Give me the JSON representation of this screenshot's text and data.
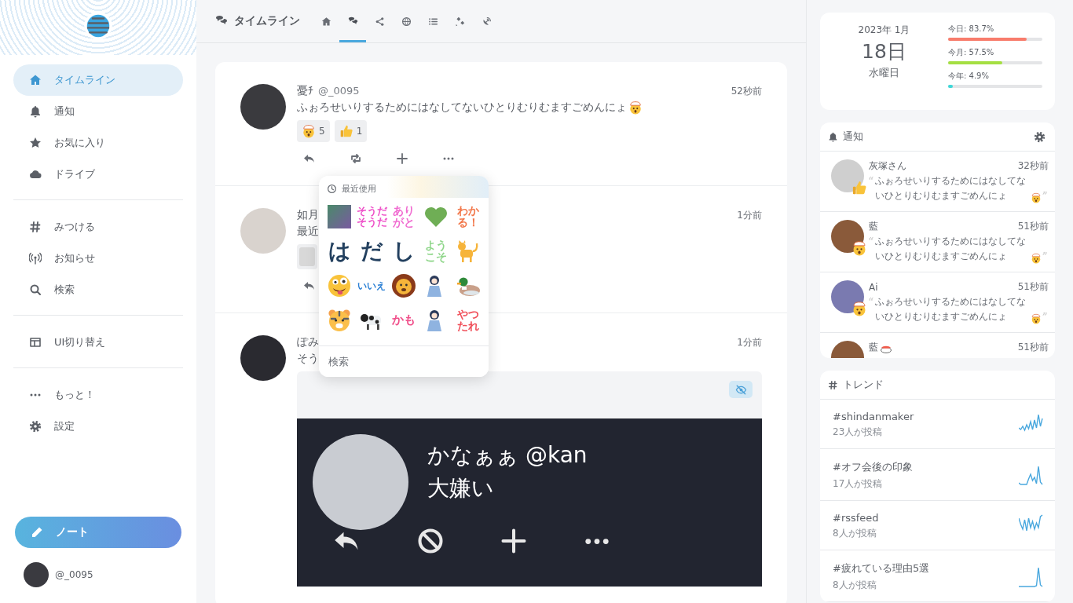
{
  "sidebar": {
    "nav_groups": [
      [
        {
          "label": "タイムライン",
          "selected": true
        },
        {
          "label": "通知",
          "selected": false
        },
        {
          "label": "お気に入り",
          "selected": false
        },
        {
          "label": "ドライブ",
          "selected": false
        }
      ],
      [
        {
          "label": "みつける",
          "selected": false
        },
        {
          "label": "お知らせ",
          "selected": false
        },
        {
          "label": "検索",
          "selected": false
        }
      ],
      [
        {
          "label": "UI切り替え",
          "selected": false
        }
      ],
      [
        {
          "label": "もっと！",
          "selected": false
        },
        {
          "label": "設定",
          "selected": false
        }
      ]
    ],
    "note_button": "ノート",
    "account": "@_0095"
  },
  "header": {
    "title": "タイムライン",
    "tabs": [
      {
        "selected": false
      },
      {
        "selected": true
      },
      {
        "selected": false
      },
      {
        "selected": false
      },
      {
        "selected": false
      },
      {
        "selected": false
      },
      {
        "selected": false
      }
    ]
  },
  "posts": [
    {
      "name": "憂ﾁ",
      "handle": "@_0095",
      "time": "52秒前",
      "text": "ふぉろせいりするためにはなしてないひとりむりむますごめんにょ",
      "text_emojis": [
        {
          "kind": "mindblown"
        }
      ],
      "reactions": [
        {
          "kind": "mindblown",
          "count": "5"
        },
        {
          "kind": "thumbsup",
          "count": "1"
        }
      ]
    },
    {
      "name": "如月",
      "time": "1分前",
      "text": "最近",
      "reactions": [
        {
          "kind": "sticker"
        }
      ]
    },
    {
      "name": "ぽみ",
      "time": "1分前",
      "text": "そう",
      "attachment": {
        "name": "かなぁぁ",
        "handle": "@kan",
        "text": "大嫌い"
      }
    }
  ],
  "emoji_picker": {
    "section": "最近使用",
    "search_placeholder": "検索",
    "emojis": [
      {
        "kind": "image"
      },
      {
        "kind": "text",
        "text": "そうだそうだ",
        "color": "#ee4fc8"
      },
      {
        "kind": "text",
        "text": "ありがと",
        "color": "#f06ad0"
      },
      {
        "kind": "heart"
      },
      {
        "kind": "text",
        "text": "わかる！",
        "color": "#f2774a"
      },
      {
        "kind": "text",
        "text": "は",
        "color": "#23405f"
      },
      {
        "kind": "text",
        "text": "だ",
        "color": "#23405f"
      },
      {
        "kind": "text",
        "text": "し",
        "color": "#23405f"
      },
      {
        "kind": "text",
        "text": "ようこそ",
        "color": "#8fd68a"
      },
      {
        "kind": "cat"
      },
      {
        "kind": "face"
      },
      {
        "kind": "text",
        "text": "いいえ",
        "color": "#2a7fd4"
      },
      {
        "kind": "lion"
      },
      {
        "kind": "person"
      },
      {
        "kind": "duck"
      },
      {
        "kind": "tiger"
      },
      {
        "kind": "cow"
      },
      {
        "kind": "text",
        "text": "かも",
        "color": "#f04f8a"
      },
      {
        "kind": "person"
      },
      {
        "kind": "text",
        "text": "やつたれ",
        "color": "#f0505a"
      }
    ]
  },
  "calendar": {
    "year_month": "2023年 1月",
    "day": "18日",
    "weekday": "水曜日",
    "meters": [
      {
        "label": "今日: 83.7%",
        "level": 0.837,
        "color": "#f87c6c"
      },
      {
        "label": "今月: 57.5%",
        "level": 0.575,
        "color": "#a5df42"
      },
      {
        "label": "今年: 4.9%",
        "level": 0.049,
        "color": "#3fd8d8"
      }
    ]
  },
  "notifications": {
    "title": "通知",
    "items": [
      {
        "name": "灰塚さん",
        "time": "32秒前",
        "reactions": [
          {
            "kind": "thumbsup"
          }
        ],
        "text": "ふぉろせいりするためにはなしてないひとりむりむますごめんにょ",
        "text_emojis": [
          {
            "kind": "mindblown"
          }
        ]
      },
      {
        "name": "藍",
        "time": "51秒前",
        "reactions": [
          {
            "kind": "mindblown"
          }
        ],
        "text": "ふぉろせいりするためにはなしてないひとりむりむますごめんにょ",
        "text_emojis": [
          {
            "kind": "mindblown"
          }
        ]
      },
      {
        "name": "Ai",
        "time": "51秒前",
        "reactions": [
          {
            "kind": "mindblown"
          }
        ],
        "text": "ふぉろせいりするためにはなしてないひとりむりむますごめんにょ",
        "text_emojis": [
          {
            "kind": "mindblown"
          }
        ]
      },
      {
        "name": "藍",
        "name_emojis": [
          {
            "kind": "sushi"
          }
        ],
        "time": "51秒前"
      }
    ]
  },
  "trends": {
    "title": "トレンド",
    "items": [
      {
        "tag": "#shindanmaker",
        "count": "23人が投稿"
      },
      {
        "tag": "#オフ会後の印象",
        "count": "17人が投稿"
      },
      {
        "tag": "#rssfeed",
        "count": "8人が投稿"
      },
      {
        "tag": "#疲れている理由5選",
        "count": "8人が投稿"
      }
    ]
  }
}
